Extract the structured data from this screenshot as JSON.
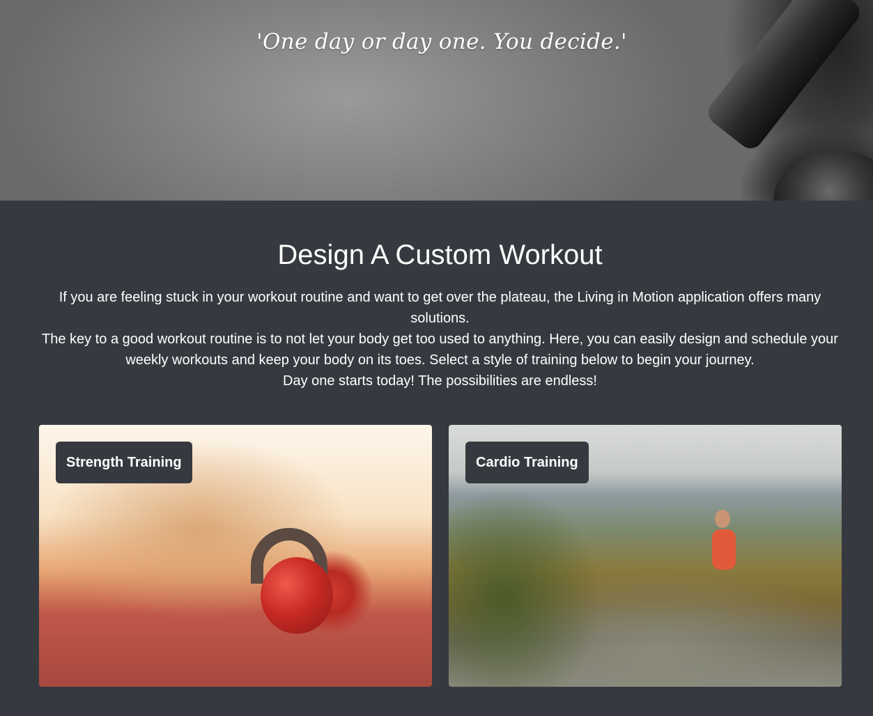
{
  "hero": {
    "quote": "'One day or day one. You decide.'"
  },
  "main": {
    "title": "Design A Custom Workout",
    "paragraphs": [
      "If you are feeling stuck in your workout routine and want to get over the plateau, the Living in Motion application offers many solutions.",
      "The key to a good workout routine is to not let your body get too used to anything. Here, you can easily design and schedule your weekly workouts and keep your body on its toes. Select a style of training below to begin your journey.",
      "Day one starts today! The possibilities are endless!"
    ]
  },
  "cards": [
    {
      "label": "Strength Training",
      "image": "kettlebell-photo"
    },
    {
      "label": "Cardio Training",
      "image": "mountain-runner-photo"
    }
  ],
  "colors": {
    "background": "#363a40",
    "text": "#ffffff",
    "label_bg": "#363a40"
  }
}
